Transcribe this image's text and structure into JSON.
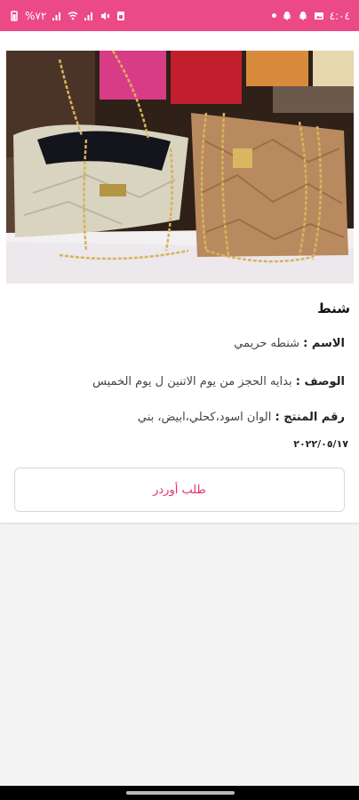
{
  "status_bar": {
    "time": "٤:٠٤",
    "battery": "%٧٢",
    "background_color": "#ec4a86"
  },
  "product": {
    "title": "شنط",
    "name_label": "الاسم :",
    "name_value": "شنطه حريمي",
    "description_label": "الوصف :",
    "description_value": "بدايه الحجز من يوم الاتنين ل يوم الخميس",
    "product_number_label": "رقم المنتج :",
    "product_number_value": "الوان اسود،كحلي،ابيض، بني",
    "date": "٢٠٢٢/٠٥/١٧",
    "image_icon": "handbags-photo"
  },
  "actions": {
    "order_button_label": "طلب أوردر",
    "accent_color": "#e2326f"
  }
}
